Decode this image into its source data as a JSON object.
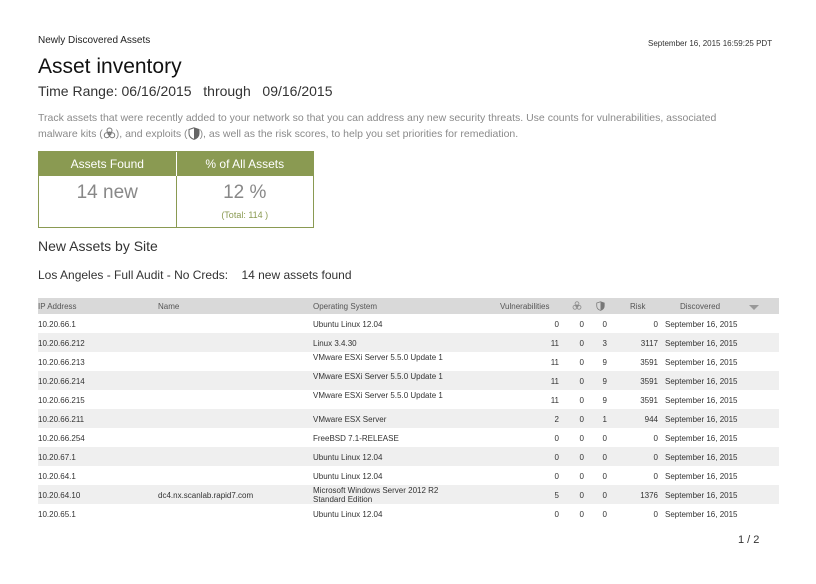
{
  "header": {
    "section": "Newly Discovered Assets",
    "timestamp": "September 16, 2015  16:59:25 PDT"
  },
  "title": "Asset inventory",
  "time_range": {
    "label": "Time Range:",
    "start": "06/16/2015",
    "through": "through",
    "end": "09/16/2015"
  },
  "description": {
    "part1": "Track assets that were recently added to your network so that you can address any new security threats. Use counts for vulnerabilities, associated malware kits (",
    "part2": "), and exploits (",
    "part3": "), as well as the risk scores, to help you set priorities for remediation."
  },
  "summary": {
    "assets_found_label": "Assets Found",
    "percent_label": "% of All Assets",
    "assets_found_value": "14 new",
    "percent_value": "12 %",
    "total": "(Total: 114 )"
  },
  "section_title": "New Assets by Site",
  "site": {
    "name": "Los Angeles - Full Audit - No Creds:",
    "count": "14 new assets found"
  },
  "table": {
    "headers": {
      "ip": "IP Address",
      "name": "Name",
      "os": "Operating System",
      "vulnerabilities": "Vulnerabilities",
      "risk": "Risk",
      "discovered": "Discovered"
    },
    "rows": [
      {
        "ip": "10.20.66.1",
        "name": "",
        "os": "Ubuntu Linux 12.04",
        "vul": "0",
        "mal": "0",
        "exp": "0",
        "risk": "0",
        "disc": "September 16, 2015"
      },
      {
        "ip": "10.20.66.212",
        "name": "",
        "os": "Linux 3.4.30",
        "vul": "11",
        "mal": "0",
        "exp": "3",
        "risk": "3117",
        "disc": "September 16, 2015"
      },
      {
        "ip": "10.20.66.213",
        "name": "",
        "os": "VMware ESXi Server 5.5.0 Update 1",
        "vul": "11",
        "mal": "0",
        "exp": "9",
        "risk": "3591",
        "disc": "September 16, 2015"
      },
      {
        "ip": "10.20.66.214",
        "name": "",
        "os": "VMware ESXi Server 5.5.0 Update 1",
        "vul": "11",
        "mal": "0",
        "exp": "9",
        "risk": "3591",
        "disc": "September 16, 2015"
      },
      {
        "ip": "10.20.66.215",
        "name": "",
        "os": "VMware ESXi Server 5.5.0 Update 1",
        "vul": "11",
        "mal": "0",
        "exp": "9",
        "risk": "3591",
        "disc": "September 16, 2015"
      },
      {
        "ip": "10.20.66.211",
        "name": "",
        "os": "VMware ESX Server",
        "vul": "2",
        "mal": "0",
        "exp": "1",
        "risk": "944",
        "disc": "September 16, 2015"
      },
      {
        "ip": "10.20.66.254",
        "name": "",
        "os": "FreeBSD 7.1-RELEASE",
        "vul": "0",
        "mal": "0",
        "exp": "0",
        "risk": "0",
        "disc": "September 16, 2015"
      },
      {
        "ip": "10.20.67.1",
        "name": "",
        "os": "Ubuntu Linux 12.04",
        "vul": "0",
        "mal": "0",
        "exp": "0",
        "risk": "0",
        "disc": "September 16, 2015"
      },
      {
        "ip": "10.20.64.1",
        "name": "",
        "os": "Ubuntu Linux 12.04",
        "vul": "0",
        "mal": "0",
        "exp": "0",
        "risk": "0",
        "disc": "September 16, 2015"
      },
      {
        "ip": "10.20.64.10",
        "name": "dc4.nx.scanlab.rapid7.com",
        "os": "Microsoft Windows Server 2012 R2 Standard Edition",
        "vul": "5",
        "mal": "0",
        "exp": "0",
        "risk": "1376",
        "disc": "September 16, 2015"
      },
      {
        "ip": "10.20.65.1",
        "name": "",
        "os": "Ubuntu Linux 12.04",
        "vul": "0",
        "mal": "0",
        "exp": "0",
        "risk": "0",
        "disc": "September 16, 2015"
      }
    ]
  },
  "page": "1 / 2"
}
